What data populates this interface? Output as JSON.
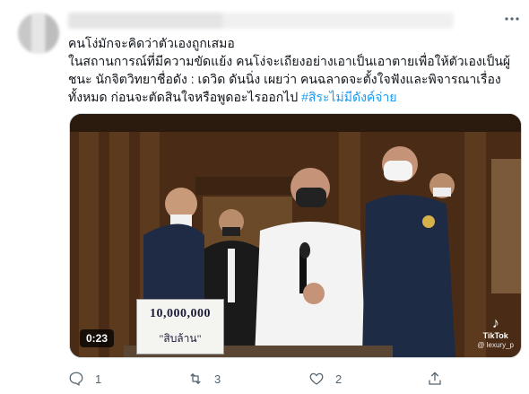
{
  "tweet": {
    "text_line1": "คนโง่มักจะคิดว่าตัวเองถูกเสมอ",
    "text_line2": "ในสถานการณ์ที่มีความขัดแย้ง คนโง่จะเถียงอย่างเอาเป็นเอาตายเพื่อให้ตัวเองเป็นผู้ชนะ นักจิตวิทยาชื่อดัง : เดวิด ดันนิ่ง เผยว่า คนฉลาดจะตั้งใจฟังและพิจารณาเรื่องทั้งหมด ก่อนจะตัดสินใจหรือพูดอะไรออกไป",
    "hashtag": "#สิระไม่มีดังค์จ่าย"
  },
  "media": {
    "duration": "0:23",
    "sign_line1": "10,000,000",
    "sign_line2": "\"สิบล้าน\"",
    "watermark_brand": "TikTok",
    "watermark_user": "@ lexury_p"
  },
  "actions": {
    "reply_count": "1",
    "retweet_count": "3",
    "like_count": "2"
  },
  "icons": {
    "more": "more-icon",
    "reply": "reply-icon",
    "retweet": "retweet-icon",
    "like": "heart-icon",
    "share": "share-icon"
  },
  "colors": {
    "hashtag": "#1d9bf0",
    "icon_gray": "#536471"
  }
}
